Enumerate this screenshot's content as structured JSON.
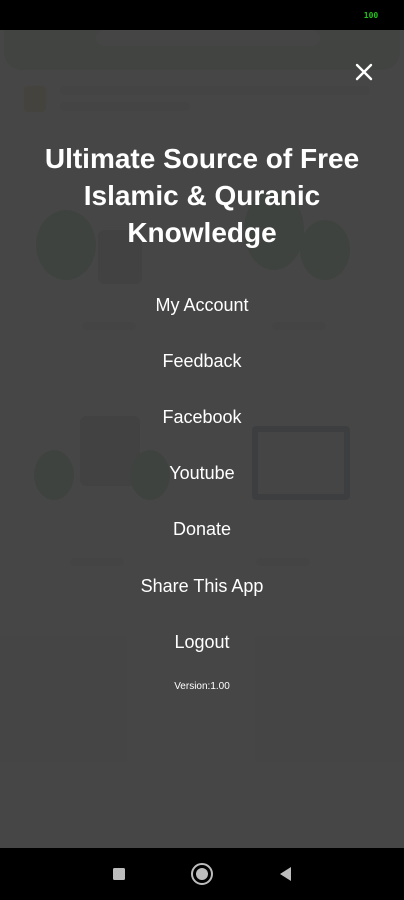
{
  "status_bar": {
    "battery": "100"
  },
  "drawer": {
    "close_icon": "close-icon",
    "headline": "Ultimate Source of Free Islamic & Quranic Knowledge",
    "menu": [
      {
        "id": "my-account",
        "label": "My Account"
      },
      {
        "id": "feedback",
        "label": "Feedback"
      },
      {
        "id": "facebook",
        "label": "Facebook"
      },
      {
        "id": "youtube",
        "label": "Youtube"
      },
      {
        "id": "donate",
        "label": "Donate"
      },
      {
        "id": "share-app",
        "label": "Share This App"
      },
      {
        "id": "logout",
        "label": "Logout"
      }
    ],
    "version": "Version:1.00"
  },
  "nav_bar": {
    "icons": [
      "recents-square-icon",
      "home-circle-icon",
      "back-triangle-icon"
    ]
  },
  "colors": {
    "overlay": "#3e3e3e",
    "text": "#ffffff",
    "battery": "#22c21a",
    "bar": "#000000"
  }
}
